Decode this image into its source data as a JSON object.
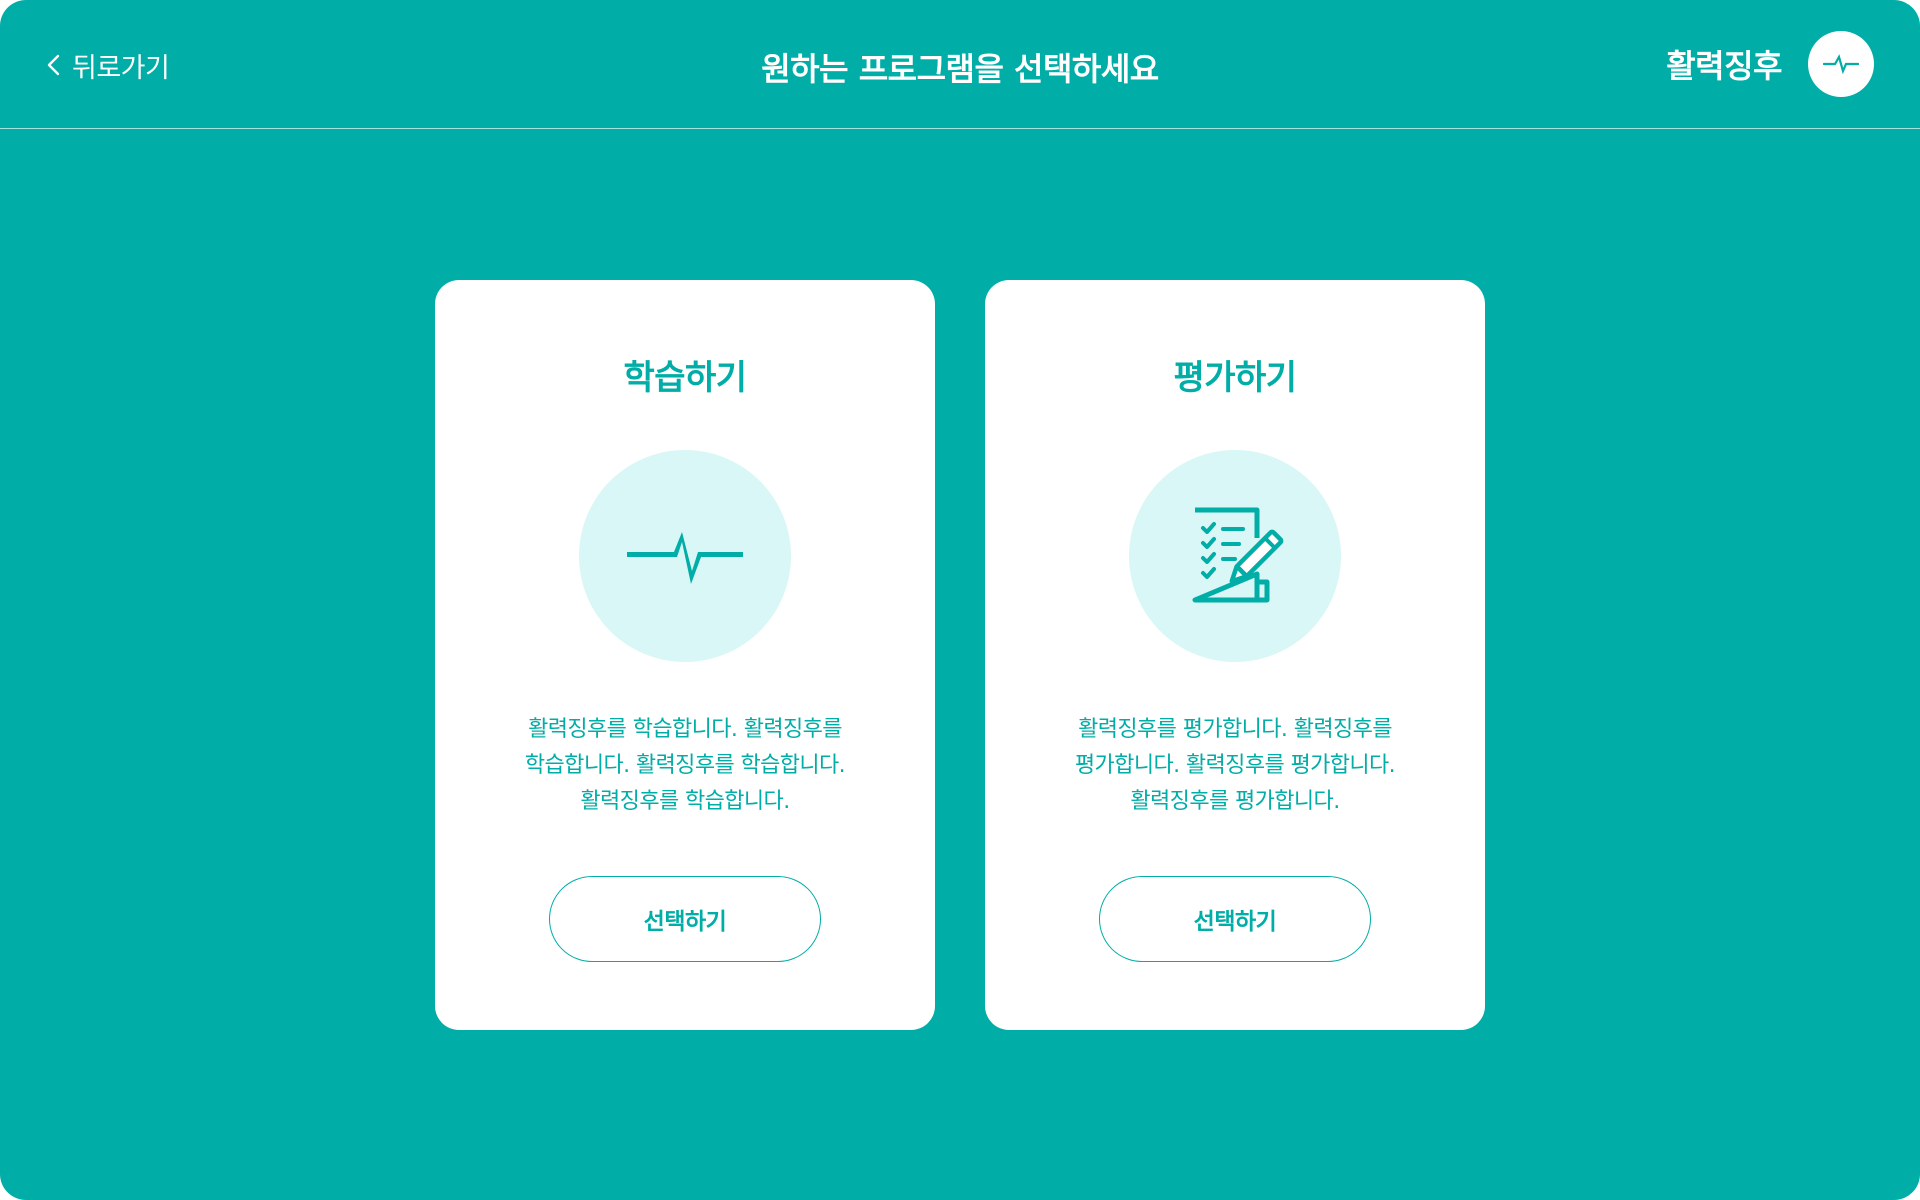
{
  "header": {
    "back_label": "뒤로가기",
    "back_icon": "chevron-left-icon",
    "title": "원하는 프로그램을 선택하세요",
    "program_name": "활력징후",
    "program_icon": "heartbeat-icon"
  },
  "cards": [
    {
      "id": "learn",
      "title": "학습하기",
      "icon": "heartbeat-icon",
      "description_lines": [
        "활력징후를 학습합니다. 활력징후를",
        "학습합니다. 활력징후를 학습합니다.",
        "활력징후를 학습합니다."
      ],
      "button_label": "선택하기"
    },
    {
      "id": "evaluate",
      "title": "평가하기",
      "icon": "checklist-pencil-icon",
      "description_lines": [
        "활력징후를 평가합니다. 활력징후를",
        "평가합니다. 활력징후를 평가합니다.",
        "활력징후를 평가합니다."
      ],
      "button_label": "선택하기"
    }
  ],
  "colors": {
    "background": "#00ADA7",
    "card": "#FFFFFF",
    "accent": "#00ADA7",
    "icon_circle": "#D8F7F6"
  }
}
